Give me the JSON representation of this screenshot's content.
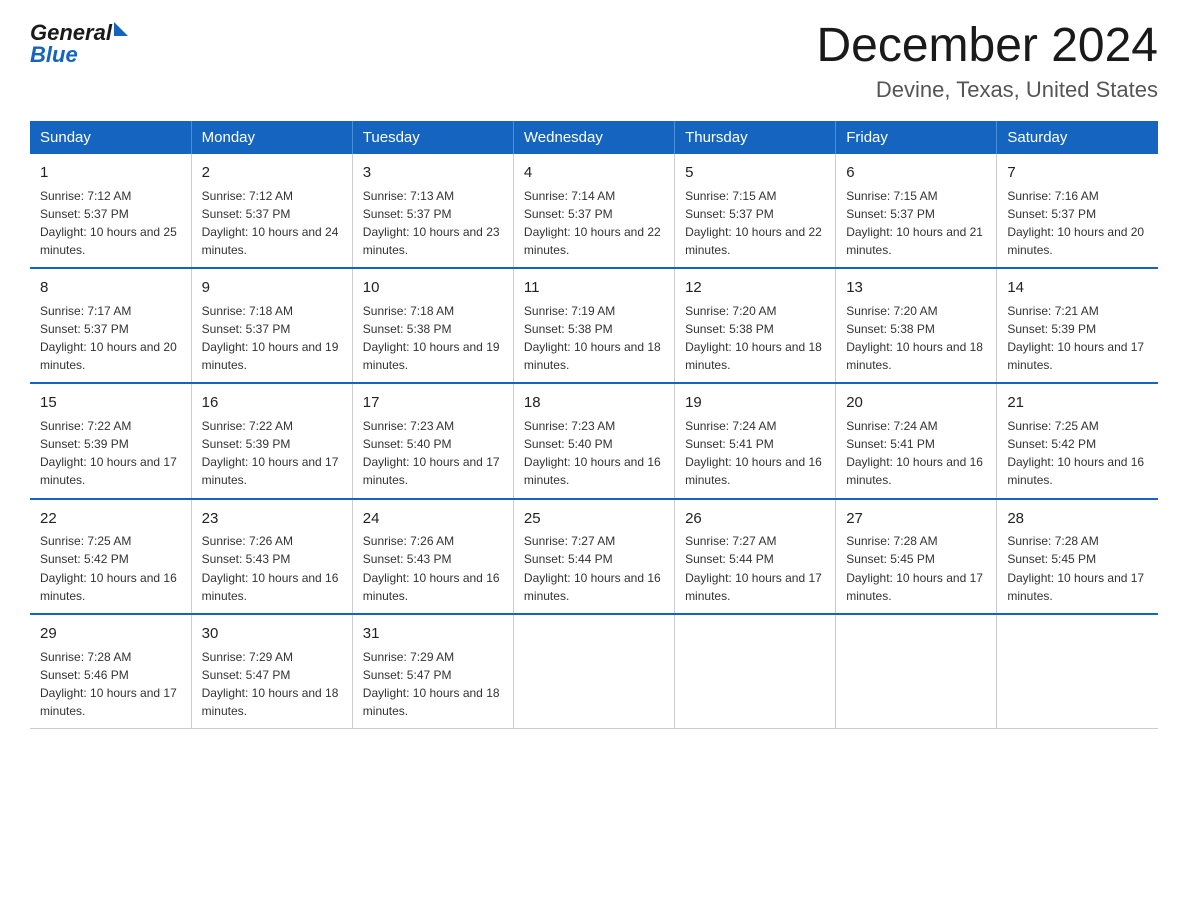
{
  "header": {
    "logo_general": "General",
    "logo_blue": "Blue",
    "title": "December 2024",
    "subtitle": "Devine, Texas, United States"
  },
  "weekdays": [
    "Sunday",
    "Monday",
    "Tuesday",
    "Wednesday",
    "Thursday",
    "Friday",
    "Saturday"
  ],
  "weeks": [
    [
      {
        "day": "1",
        "sunrise": "7:12 AM",
        "sunset": "5:37 PM",
        "daylight": "10 hours and 25 minutes."
      },
      {
        "day": "2",
        "sunrise": "7:12 AM",
        "sunset": "5:37 PM",
        "daylight": "10 hours and 24 minutes."
      },
      {
        "day": "3",
        "sunrise": "7:13 AM",
        "sunset": "5:37 PM",
        "daylight": "10 hours and 23 minutes."
      },
      {
        "day": "4",
        "sunrise": "7:14 AM",
        "sunset": "5:37 PM",
        "daylight": "10 hours and 22 minutes."
      },
      {
        "day": "5",
        "sunrise": "7:15 AM",
        "sunset": "5:37 PM",
        "daylight": "10 hours and 22 minutes."
      },
      {
        "day": "6",
        "sunrise": "7:15 AM",
        "sunset": "5:37 PM",
        "daylight": "10 hours and 21 minutes."
      },
      {
        "day": "7",
        "sunrise": "7:16 AM",
        "sunset": "5:37 PM",
        "daylight": "10 hours and 20 minutes."
      }
    ],
    [
      {
        "day": "8",
        "sunrise": "7:17 AM",
        "sunset": "5:37 PM",
        "daylight": "10 hours and 20 minutes."
      },
      {
        "day": "9",
        "sunrise": "7:18 AM",
        "sunset": "5:37 PM",
        "daylight": "10 hours and 19 minutes."
      },
      {
        "day": "10",
        "sunrise": "7:18 AM",
        "sunset": "5:38 PM",
        "daylight": "10 hours and 19 minutes."
      },
      {
        "day": "11",
        "sunrise": "7:19 AM",
        "sunset": "5:38 PM",
        "daylight": "10 hours and 18 minutes."
      },
      {
        "day": "12",
        "sunrise": "7:20 AM",
        "sunset": "5:38 PM",
        "daylight": "10 hours and 18 minutes."
      },
      {
        "day": "13",
        "sunrise": "7:20 AM",
        "sunset": "5:38 PM",
        "daylight": "10 hours and 18 minutes."
      },
      {
        "day": "14",
        "sunrise": "7:21 AM",
        "sunset": "5:39 PM",
        "daylight": "10 hours and 17 minutes."
      }
    ],
    [
      {
        "day": "15",
        "sunrise": "7:22 AM",
        "sunset": "5:39 PM",
        "daylight": "10 hours and 17 minutes."
      },
      {
        "day": "16",
        "sunrise": "7:22 AM",
        "sunset": "5:39 PM",
        "daylight": "10 hours and 17 minutes."
      },
      {
        "day": "17",
        "sunrise": "7:23 AM",
        "sunset": "5:40 PM",
        "daylight": "10 hours and 17 minutes."
      },
      {
        "day": "18",
        "sunrise": "7:23 AM",
        "sunset": "5:40 PM",
        "daylight": "10 hours and 16 minutes."
      },
      {
        "day": "19",
        "sunrise": "7:24 AM",
        "sunset": "5:41 PM",
        "daylight": "10 hours and 16 minutes."
      },
      {
        "day": "20",
        "sunrise": "7:24 AM",
        "sunset": "5:41 PM",
        "daylight": "10 hours and 16 minutes."
      },
      {
        "day": "21",
        "sunrise": "7:25 AM",
        "sunset": "5:42 PM",
        "daylight": "10 hours and 16 minutes."
      }
    ],
    [
      {
        "day": "22",
        "sunrise": "7:25 AM",
        "sunset": "5:42 PM",
        "daylight": "10 hours and 16 minutes."
      },
      {
        "day": "23",
        "sunrise": "7:26 AM",
        "sunset": "5:43 PM",
        "daylight": "10 hours and 16 minutes."
      },
      {
        "day": "24",
        "sunrise": "7:26 AM",
        "sunset": "5:43 PM",
        "daylight": "10 hours and 16 minutes."
      },
      {
        "day": "25",
        "sunrise": "7:27 AM",
        "sunset": "5:44 PM",
        "daylight": "10 hours and 16 minutes."
      },
      {
        "day": "26",
        "sunrise": "7:27 AM",
        "sunset": "5:44 PM",
        "daylight": "10 hours and 17 minutes."
      },
      {
        "day": "27",
        "sunrise": "7:28 AM",
        "sunset": "5:45 PM",
        "daylight": "10 hours and 17 minutes."
      },
      {
        "day": "28",
        "sunrise": "7:28 AM",
        "sunset": "5:45 PM",
        "daylight": "10 hours and 17 minutes."
      }
    ],
    [
      {
        "day": "29",
        "sunrise": "7:28 AM",
        "sunset": "5:46 PM",
        "daylight": "10 hours and 17 minutes."
      },
      {
        "day": "30",
        "sunrise": "7:29 AM",
        "sunset": "5:47 PM",
        "daylight": "10 hours and 18 minutes."
      },
      {
        "day": "31",
        "sunrise": "7:29 AM",
        "sunset": "5:47 PM",
        "daylight": "10 hours and 18 minutes."
      },
      null,
      null,
      null,
      null
    ]
  ],
  "labels": {
    "sunrise_prefix": "Sunrise: ",
    "sunset_prefix": "Sunset: ",
    "daylight_prefix": "Daylight: "
  }
}
